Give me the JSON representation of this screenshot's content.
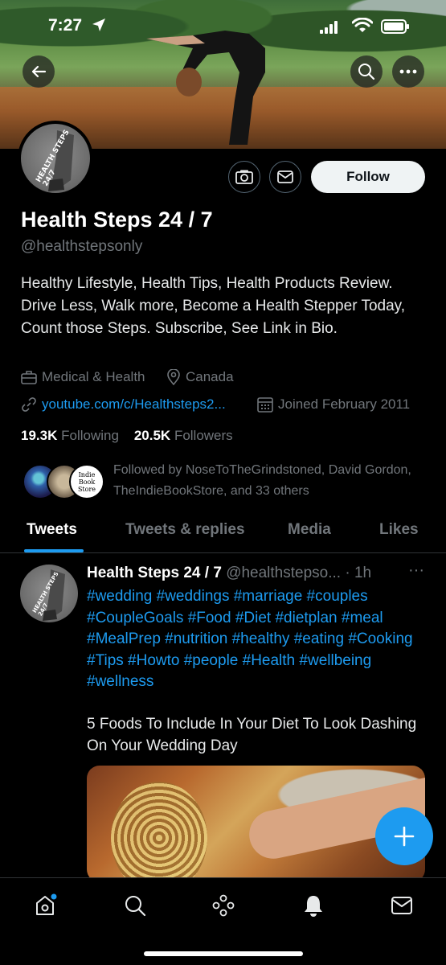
{
  "status_bar": {
    "time": "7:27"
  },
  "profile": {
    "avatar_text": "HEALTH STEPS 24/7",
    "name": "Health Steps 24 / 7",
    "handle": "@healthstepsonly",
    "follow_label": "Follow",
    "bio": "Healthy Lifestyle, Health Tips, Health Products Review. Drive Less, Walk more, Become a Health Stepper Today, Count those Steps. Subscribe, See Link in Bio.",
    "category": "Medical & Health",
    "location": "Canada",
    "link": "youtube.com/c/Healthsteps2...",
    "joined": "Joined February 2011",
    "following_count": "19.3K",
    "following_label": "Following",
    "followers_count": "20.5K",
    "followers_label": "Followers",
    "followed_by": "Followed by NoseToTheGrindstoned, David Gordon, TheIndieBookStore, and 33 others",
    "indie_avatar_text": "Indie Book Store"
  },
  "tabs": [
    "Tweets",
    "Tweets & replies",
    "Media",
    "Likes"
  ],
  "active_tab": "Tweets",
  "tweet": {
    "author": "Health Steps 24 / 7",
    "handle_time": "@healthstepso... · 1h",
    "hashtags": "#wedding #weddings #marriage #couples #CoupleGoals #Food #Diet #dietplan #meal #MealPrep #nutrition #healthy #eating #Cooking #Tips #Howto #people #Health #wellbeing #wellness",
    "text": "5 Foods To Include In Your Diet To Look Dashing On Your Wedding Day",
    "more": "···"
  },
  "colors": {
    "accent": "#1d9bf0",
    "background": "#000000",
    "muted": "#71767b"
  },
  "icons": [
    "back-arrow-icon",
    "search-icon",
    "more-icon",
    "camera-icon",
    "mail-icon",
    "briefcase-icon",
    "location-icon",
    "link-icon",
    "calendar-icon",
    "compose-plus-icon",
    "home-icon",
    "explore-icon",
    "spaces-icon",
    "bell-icon",
    "messages-icon"
  ]
}
